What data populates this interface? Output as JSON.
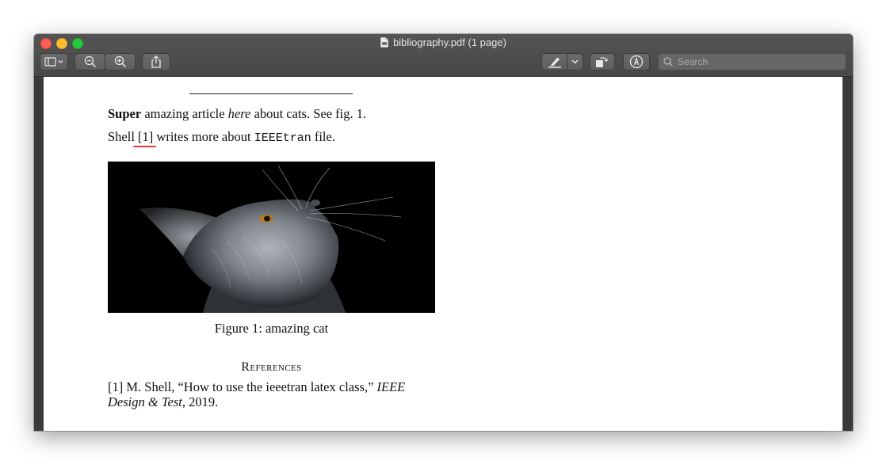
{
  "window": {
    "title": "bibliography.pdf (1 page)"
  },
  "toolbar": {
    "buttons": [
      {
        "name": "sidebar-toggle",
        "icon": "sidebar-icon"
      },
      {
        "name": "zoom-out",
        "icon": "zoom-out-icon"
      },
      {
        "name": "zoom-in",
        "icon": "zoom-in-icon"
      },
      {
        "name": "share",
        "icon": "share-icon"
      },
      {
        "name": "highlight",
        "icon": "highlighter-icon"
      },
      {
        "name": "rotate",
        "icon": "rotate-icon"
      },
      {
        "name": "markup",
        "icon": "markup-pen-icon"
      }
    ],
    "search_placeholder": "Search"
  },
  "document": {
    "para1": {
      "bold": "Super",
      "text_a": " amazing article ",
      "italic": "here",
      "text_b": " about cats. See fig. 1."
    },
    "para2": {
      "text_a": "Shell ",
      "cite": "[1]",
      "text_b": " writes more about ",
      "mono": "IEEEtran",
      "text_c": " file."
    },
    "figure_caption": "Figure 1: amazing cat",
    "references": {
      "heading": "References",
      "entry_label": "[1] ",
      "entry_text": "M. Shell, “How to use the ieeetran latex class,” ",
      "journal_part1": "IEEE",
      "journal_part2": "Design & Test",
      "year": ", 2019."
    }
  },
  "colors": {
    "citation_underline": "#e53935",
    "toolbar_bg": "#545454"
  }
}
